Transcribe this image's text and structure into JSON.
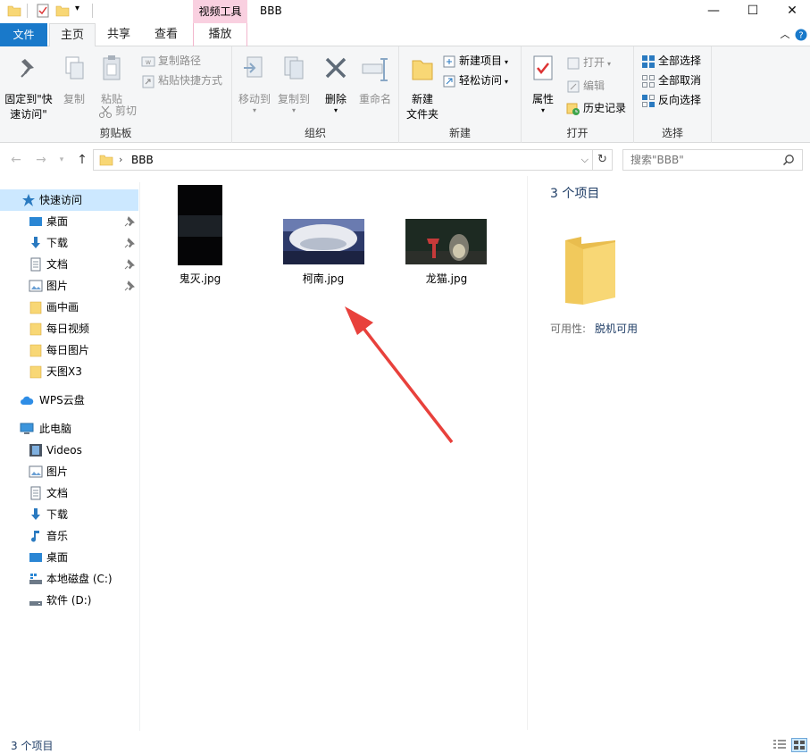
{
  "window": {
    "title": "BBB",
    "contextual_tab": "视频工具",
    "controls": {
      "minimize": "—",
      "maximize": "☐",
      "close": "✕"
    }
  },
  "tabs": {
    "file": "文件",
    "home": "主页",
    "share": "共享",
    "view": "查看",
    "play": "播放"
  },
  "ribbon": {
    "clipboard": {
      "label": "剪贴板",
      "pin_line1": "固定到\"快",
      "pin_line2": "速访问\"",
      "copy": "复制",
      "paste": "粘贴",
      "copy_path": "复制路径",
      "paste_shortcut": "粘贴快捷方式",
      "cut": "剪切"
    },
    "organize": {
      "label": "组织",
      "move_to": "移动到",
      "copy_to": "复制到",
      "delete": "删除",
      "rename": "重命名"
    },
    "new": {
      "label": "新建",
      "new_folder_line1": "新建",
      "new_folder_line2": "文件夹",
      "new_item": "新建项目",
      "easy_access": "轻松访问"
    },
    "open": {
      "label": "打开",
      "properties": "属性",
      "open": "打开",
      "edit": "编辑",
      "history": "历史记录"
    },
    "select": {
      "label": "选择",
      "select_all": "全部选择",
      "select_none": "全部取消",
      "invert": "反向选择"
    }
  },
  "address": {
    "path": "BBB",
    "search_placeholder": "搜索\"BBB\""
  },
  "sidebar": {
    "quick_access": "快速访问",
    "quick_items": [
      "桌面",
      "下载",
      "文档",
      "图片",
      "画中画",
      "每日视频",
      "每日图片",
      "天图X3"
    ],
    "wps": "WPS云盘",
    "this_pc": "此电脑",
    "pc_items": [
      "Videos",
      "图片",
      "文档",
      "下载",
      "音乐",
      "桌面",
      "本地磁盘 (C:)",
      "软件 (D:)"
    ]
  },
  "files": [
    {
      "name": "鬼灭.jpg"
    },
    {
      "name": "柯南.jpg"
    },
    {
      "name": "龙猫.jpg"
    }
  ],
  "preview": {
    "count": "3 个项目",
    "availability_label": "可用性:",
    "availability_value": "脱机可用"
  },
  "status": {
    "count": "3 个项目"
  },
  "colors": {
    "accent": "#1979ca",
    "selection": "#cce8ff",
    "folder": "#f8d775",
    "arrow": "#e8413c"
  }
}
